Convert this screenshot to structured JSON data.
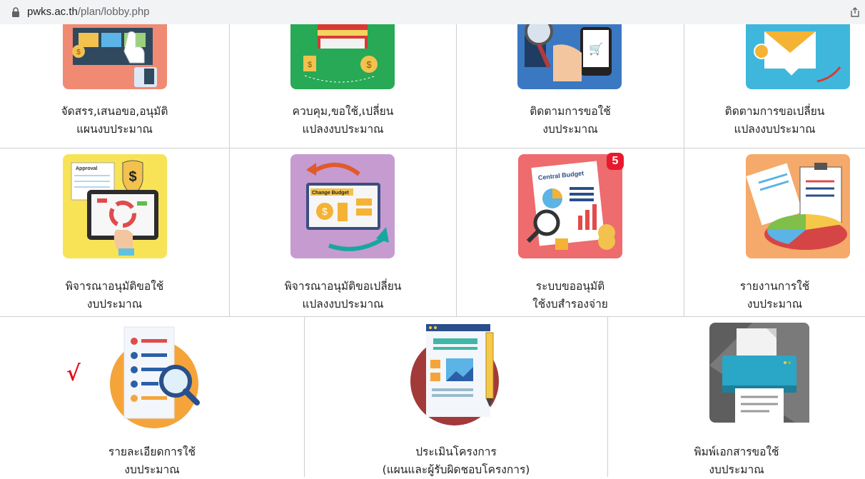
{
  "browser": {
    "url_host": "pwks.ac.th",
    "url_path": "/plan/lobby.php"
  },
  "menu_rows": [
    {
      "items": [
        {
          "line1": "จัดสรร,เสนอขอ,อนุมัติ",
          "line2": "แผนงบประมาณ",
          "icon": "allocate-budget-icon"
        },
        {
          "line1": "ควบคุม,ขอใช้,เปลี่ยน",
          "line2": "แปลงงบประมาณ",
          "icon": "control-budget-icon"
        },
        {
          "line1": "ติดตามการขอใช้",
          "line2": "งบประมาณ",
          "icon": "track-request-icon"
        },
        {
          "line1": "ติดตามการขอเปลี่ยน",
          "line2": "แปลงงบประมาณ",
          "icon": "track-change-icon"
        }
      ]
    },
    {
      "items": [
        {
          "line1": "พิจารณาอนุมัติขอใช้",
          "line2": "งบประมาณ",
          "icon": "approval-icon"
        },
        {
          "line1": "พิจารณาอนุมัติขอเปลี่ยน",
          "line2": "แปลงงบประมาณ",
          "icon": "change-budget-icon"
        },
        {
          "line1": "ระบบขออนุมัติ",
          "line2": "ใช้งบสำรองจ่าย",
          "icon": "central-budget-icon",
          "badge": "5"
        },
        {
          "line1": "รายงานการใช้",
          "line2": "งบประมาณ",
          "icon": "report-chart-icon"
        }
      ]
    },
    {
      "items": [
        {
          "line1": "รายละเอียดการใช้",
          "line2": "งบประมาณ",
          "icon": "detail-search-icon"
        },
        {
          "line1": "ประเมินโครงการ",
          "line2": "(แผนและผู้รับผิดชอบโครงการ)",
          "icon": "project-evaluation-icon"
        },
        {
          "line1": "พิมพ์เอกสารขอใช้",
          "line2": "งบประมาณ",
          "icon": "printer-icon"
        }
      ]
    }
  ],
  "check_mark": "√",
  "icon_images": {
    "allocate_budget": "Approval",
    "change_budget": "Change Budget",
    "central_budget": "Central Budget"
  }
}
